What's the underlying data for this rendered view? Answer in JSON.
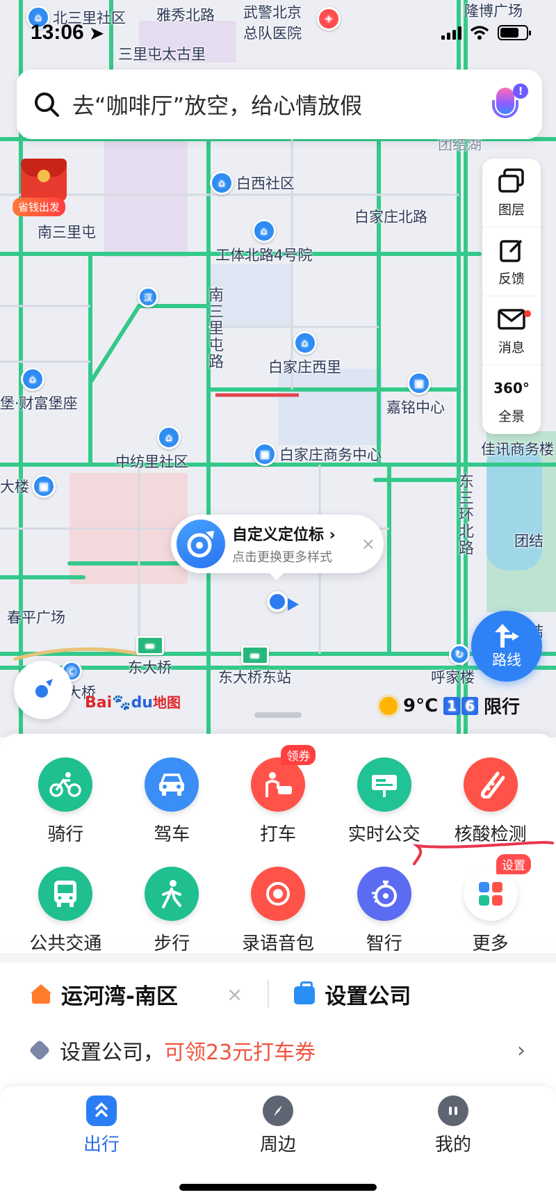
{
  "status": {
    "time": "13:06"
  },
  "search": {
    "placeholder": "去“咖啡厅”放空，给心情放假",
    "mic_badge": "!"
  },
  "promo": {
    "label": "省钱出发"
  },
  "map": {
    "pois": [
      {
        "id": "p1",
        "label": "北三里社区"
      },
      {
        "id": "p2",
        "label": "雅秀北路"
      },
      {
        "id": "p3",
        "label": "武警北京"
      },
      {
        "id": "p3b",
        "label": "总队医院"
      },
      {
        "id": "p4",
        "label": "隆博广场"
      },
      {
        "id": "p5",
        "label": "三里屯太古里"
      },
      {
        "id": "p6",
        "label": "白西社区"
      },
      {
        "id": "p7",
        "label": "南三里屯"
      },
      {
        "id": "p8",
        "label": "白家庄北路"
      },
      {
        "id": "p9",
        "label": "工体北路4号院"
      },
      {
        "id": "p10",
        "label": "汉庭"
      },
      {
        "id": "p11",
        "label": "白家庄西里"
      },
      {
        "id": "p12",
        "label": "嘉铭中心"
      },
      {
        "id": "p13",
        "label": "堡·财富堡座"
      },
      {
        "id": "p14",
        "label": "中纺里社区"
      },
      {
        "id": "p15",
        "label": "白家庄商务中心"
      },
      {
        "id": "p16",
        "label": "佳讯商务楼"
      },
      {
        "id": "p17",
        "label": "大楼"
      },
      {
        "id": "p18",
        "label": "团结"
      },
      {
        "id": "p19",
        "label": "春平广场"
      },
      {
        "id": "p20",
        "label": "东大桥"
      },
      {
        "id": "p21",
        "label": "东大桥东站"
      },
      {
        "id": "p22",
        "label": "呼家楼"
      },
      {
        "id": "p23",
        "label": "大桥"
      },
      {
        "id": "p24",
        "label": "团结湖"
      },
      {
        "id": "p25",
        "label": "团结"
      }
    ],
    "roads": {
      "nansanlitun": "南三里屯路",
      "dongsanhuan": "东三环北路"
    }
  },
  "tools": [
    {
      "id": "layers",
      "label": "图层",
      "icon": "layers-icon"
    },
    {
      "id": "feedback",
      "label": "反馈",
      "icon": "edit-icon"
    },
    {
      "id": "messages",
      "label": "消息",
      "icon": "mail-icon"
    },
    {
      "id": "panorama",
      "label": "全景",
      "icon": "panorama-360-icon",
      "icon_text": "360°"
    }
  ],
  "callout": {
    "title": "自定义定位标",
    "subtitle": "点击更换更多样式",
    "close": "×"
  },
  "route_button": {
    "label": "路线"
  },
  "logo": {
    "part1": "Bai",
    "part2": "du",
    "part3": "地图"
  },
  "weather": {
    "temp": "9°C",
    "plate_1": "1",
    "plate_2": "6",
    "limit": "限行"
  },
  "grid": [
    {
      "id": "cycling",
      "label": "骑行",
      "icon": "bicycle-icon",
      "color": "#1fbf8f"
    },
    {
      "id": "driving",
      "label": "驾车",
      "icon": "car-icon",
      "color": "#3a8ef6"
    },
    {
      "id": "taxi",
      "label": "打车",
      "icon": "taxi-icon",
      "color": "#ff5349",
      "badge": "领券"
    },
    {
      "id": "realtime_bus",
      "label": "实时公交",
      "icon": "bus-stop-icon",
      "color": "#21c295"
    },
    {
      "id": "covid_test",
      "label": "核酸检测",
      "icon": "test-tube-icon",
      "color": "#ff5349"
    },
    {
      "id": "transit",
      "label": "公共交通",
      "icon": "bus-icon",
      "color": "#1fbf8f"
    },
    {
      "id": "walking",
      "label": "步行",
      "icon": "walk-icon",
      "color": "#1fbf8f"
    },
    {
      "id": "voice_pack",
      "label": "录语音包",
      "icon": "record-icon",
      "color": "#ff5349"
    },
    {
      "id": "smart_travel",
      "label": "智行",
      "icon": "stopwatch-icon",
      "color": "#5b6cf2"
    },
    {
      "id": "more",
      "label": "更多",
      "icon": "apps-grid-icon",
      "color": "#ffffff",
      "badge": "设置"
    }
  ],
  "addresses": {
    "home": "运河湾-南区",
    "clear": "×",
    "company": "设置公司"
  },
  "coupon": {
    "prefix": "设置公司，",
    "highlight": "可领23元打车券",
    "chevron": "›"
  },
  "tabs": [
    {
      "id": "travel",
      "label": "出行",
      "icon": "travel-icon",
      "active": true
    },
    {
      "id": "nearby",
      "label": "周边",
      "icon": "compass-icon",
      "active": false
    },
    {
      "id": "mine",
      "label": "我的",
      "icon": "profile-icon",
      "active": false
    }
  ]
}
